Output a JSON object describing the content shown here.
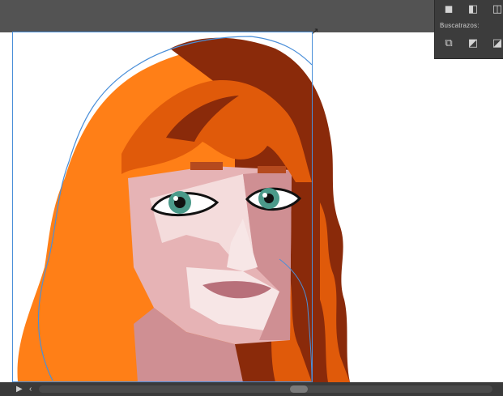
{
  "window": {
    "toolbar_color": "#535353",
    "canvas_color": "#ffffff"
  },
  "pathfinder_panel": {
    "shape_mode_icons": [
      "unite-icon",
      "minus-front-icon",
      "intersect-icon"
    ],
    "section_label": "Buscatrazos:",
    "pathfinder_icons": [
      "divide-icon",
      "trim-icon",
      "merge-icon"
    ]
  },
  "selection": {
    "color": "#4a8fd9"
  },
  "artwork": {
    "subject": "vector-portrait",
    "colors": {
      "hair_light": "#ff7f17",
      "hair_mid": "#e05a0a",
      "hair_dark": "#8a2a0a",
      "skin_light": "#f4dcdc",
      "skin_mid": "#e6b3b5",
      "skin_shadow": "#cf8f93",
      "lips": "#b8707a",
      "iris": "#4b9a8a"
    }
  },
  "statusbar": {
    "scroll_left_icon": "play-icon",
    "scroll_prev_icon": "chevron-left-icon"
  }
}
